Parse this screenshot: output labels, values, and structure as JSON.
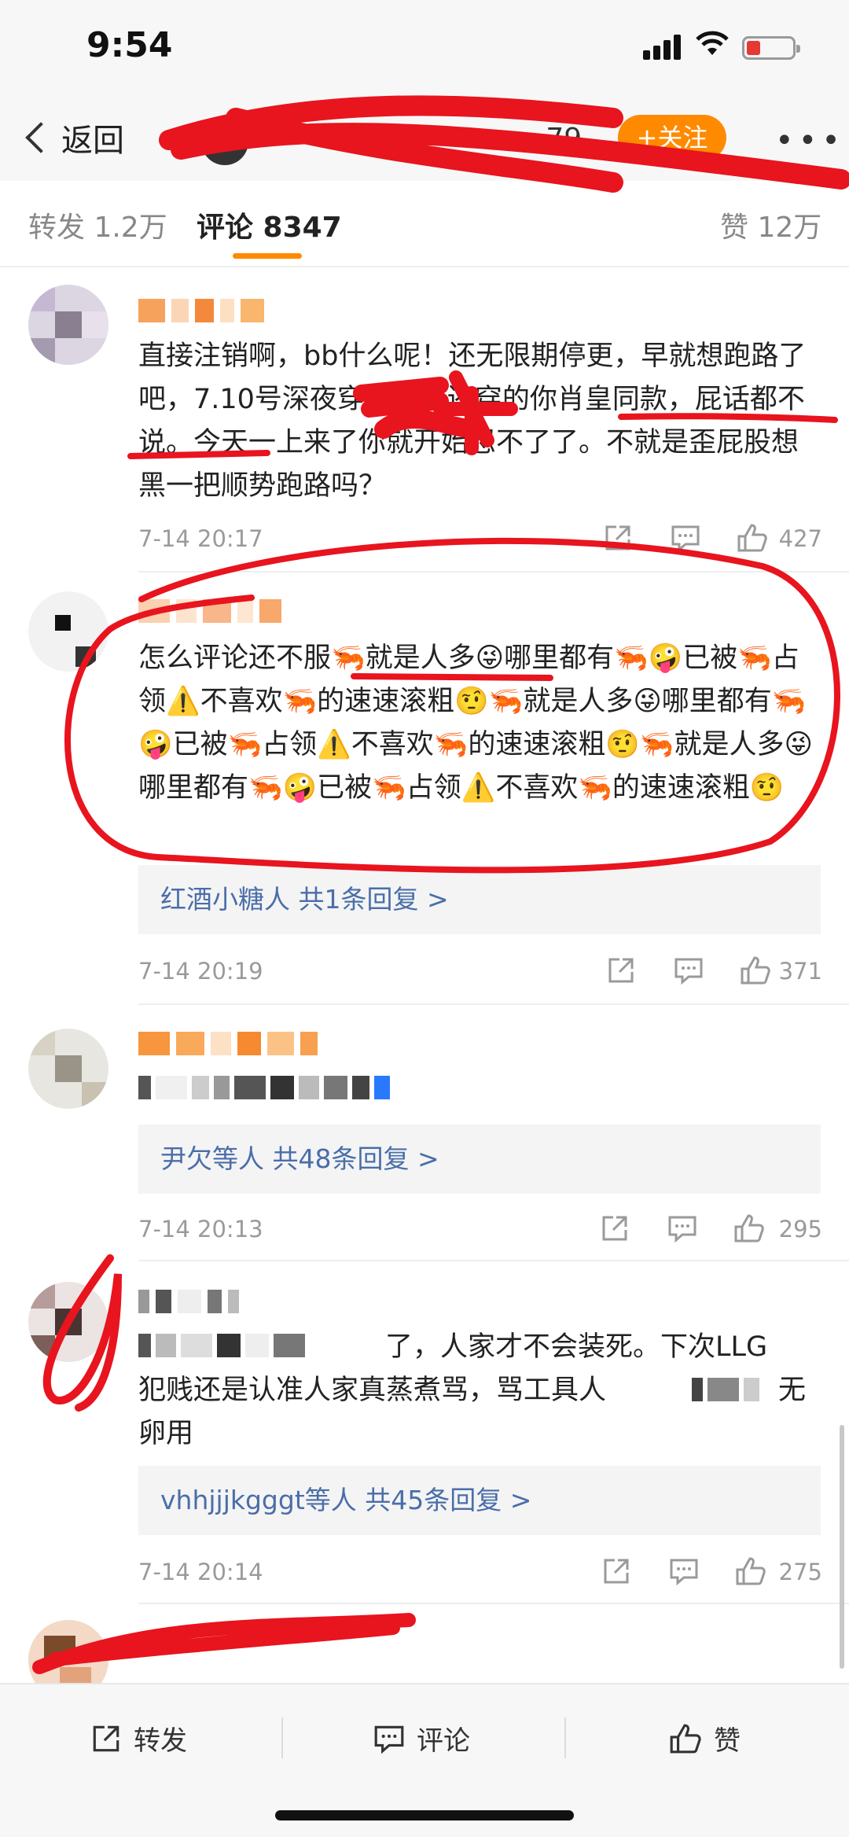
{
  "status_bar": {
    "time": "9:54",
    "battery_level": 0.3
  },
  "nav": {
    "back_label": "返回",
    "follow_label": "+关注",
    "more_label": "•••",
    "name_fragment": "...79"
  },
  "tabs": [
    {
      "label": "转发 1.2万"
    },
    {
      "label": "评论 8347"
    },
    {
      "label": "赞 12万"
    }
  ],
  "comments": [
    {
      "text": "直接注销啊，bb什么呢！还无限期停更，早就想跑路了吧，7.10号深夜穿李子，还穿的你肖皇同款，屁话都不说。今天一上来了你就开始忍不了了。不就是歪屁股想黑一把顺势跑路吗？",
      "date": "7-14 20:17",
      "likes": "427"
    },
    {
      "text": "怎么评论还不服🦐就是人多😜哪里都有🦐🤪已被🦐占领⚠️不喜欢🦐的速速滚粗🤨🦐就是人多😜哪里都有🦐🤪已被🦐占领⚠️不喜欢🦐的速速滚粗🤨🦐就是人多😜哪里都有🦐🤪已被🦐占领⚠️不喜欢🦐的速速滚粗🤨",
      "replies": "红酒小糖人  共1条回复 >",
      "date": "7-14 20:19",
      "likes": "371"
    },
    {
      "replies": "尹欠等人  共48条回复 >",
      "date": "7-14 20:13",
      "likes": "295"
    },
    {
      "text_a": "了，人家才不会装死。下次LLG",
      "text_b": "犯贱还是认准人家真蒸煮骂，骂工具人",
      "text_b2": "无",
      "text_c": "卵用",
      "replies": "vhhjjjkgggt等人  共45条回复 >",
      "date": "7-14 20:14",
      "likes": "275"
    }
  ],
  "bottom_bar": {
    "repost": "转发",
    "comment": "评论",
    "like": "赞"
  },
  "colors": {
    "accent": "#ff8a00",
    "link": "#4a6ea9",
    "annotation": "#e8141e"
  }
}
